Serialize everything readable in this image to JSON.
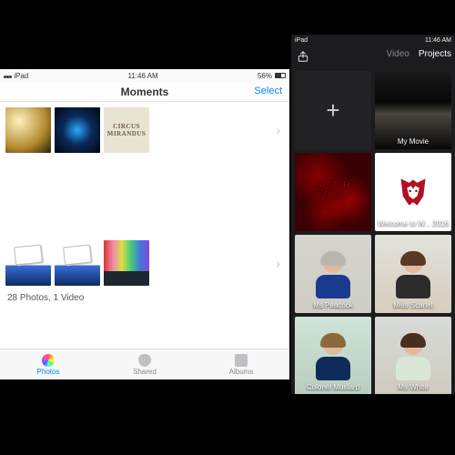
{
  "photos": {
    "statusbar": {
      "carrier": "iPad",
      "time": "11:46 AM",
      "battery": "56%"
    },
    "nav": {
      "title": "Moments",
      "select": "Select"
    },
    "rows": {
      "r1": {
        "circus_line1": "CIRCUS",
        "circus_line2": "MIRANDUS"
      }
    },
    "summary": "28 Photos, 1 Video",
    "tabs": {
      "photos": "Photos",
      "shared": "Shared",
      "albums": "Albums"
    }
  },
  "imovie": {
    "statusbar": {
      "carrier": "iPad",
      "time": "11:46 AM"
    },
    "tabs": {
      "video": "Video",
      "projects": "Projects"
    },
    "projects": {
      "mymovie": "My Movie",
      "super_l1": "SUPER",
      "super_l2": "FAMILY",
      "wolf": "Welcome to W... 2016",
      "peacock": "Ms Peacock",
      "scarlet": "Miss Scarlet",
      "mustard": "Colonel Mustard",
      "white": "Ms White"
    }
  }
}
